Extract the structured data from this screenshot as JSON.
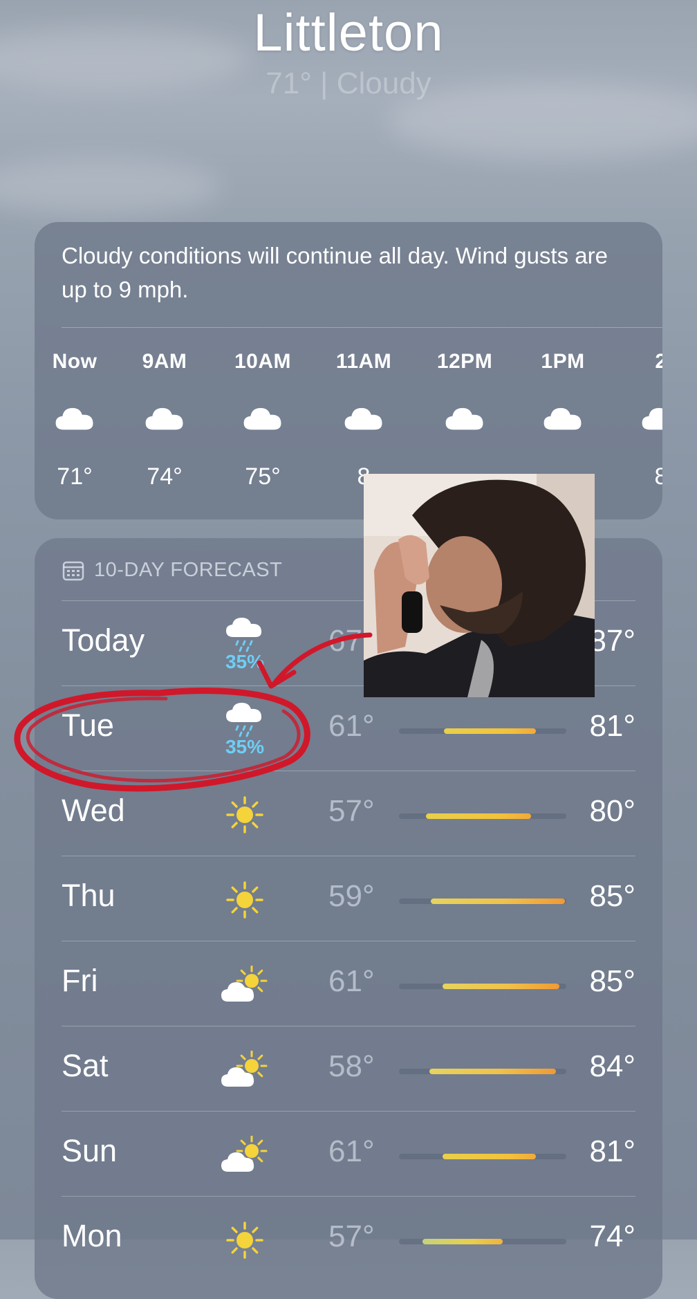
{
  "header": {
    "city": "Littleton",
    "subtitle": "71°  |  Cloudy"
  },
  "summary": {
    "text": "Cloudy conditions will continue all day. Wind gusts are up to 9 mph."
  },
  "hourly": [
    {
      "time": "Now",
      "icon": "cloud-icon",
      "temp": "71°"
    },
    {
      "time": "9AM",
      "icon": "cloud-icon",
      "temp": "74°"
    },
    {
      "time": "10AM",
      "icon": "cloud-icon",
      "temp": "75°"
    },
    {
      "time": "11AM",
      "icon": "cloud-icon",
      "temp": "8"
    },
    {
      "time": "12PM",
      "icon": "cloud-icon",
      "temp": ""
    },
    {
      "time": "1PM",
      "icon": "cloud-icon",
      "temp": ""
    },
    {
      "time": "2",
      "icon": "cloud-icon",
      "temp": "8"
    }
  ],
  "forecast": {
    "title": "10-DAY FORECAST",
    "icon": "calendar-icon",
    "days": [
      {
        "day": "Today",
        "icon": "cloud-rain-icon",
        "precip": "35%",
        "low": "67",
        "high": "87°",
        "range": [
          0.0,
          0.0
        ]
      },
      {
        "day": "Tue",
        "icon": "cloud-rain-icon",
        "precip": "35%",
        "low": "61°",
        "high": "81°",
        "range": [
          0.27,
          0.82
        ]
      },
      {
        "day": "Wed",
        "icon": "sun-icon",
        "precip": "",
        "low": "57°",
        "high": "80°",
        "range": [
          0.16,
          0.79
        ]
      },
      {
        "day": "Thu",
        "icon": "sun-icon",
        "precip": "",
        "low": "59°",
        "high": "85°",
        "range": [
          0.19,
          0.99
        ]
      },
      {
        "day": "Fri",
        "icon": "partly-sunny-icon",
        "precip": "",
        "low": "61°",
        "high": "85°",
        "range": [
          0.26,
          0.96
        ]
      },
      {
        "day": "Sat",
        "icon": "partly-sunny-icon",
        "precip": "",
        "low": "58°",
        "high": "84°",
        "range": [
          0.18,
          0.94
        ]
      },
      {
        "day": "Sun",
        "icon": "partly-sunny-icon",
        "precip": "",
        "low": "61°",
        "high": "81°",
        "range": [
          0.26,
          0.82
        ]
      },
      {
        "day": "Mon",
        "icon": "sun-icon",
        "precip": "",
        "low": "57°",
        "high": "74°",
        "range": [
          0.14,
          0.62
        ]
      }
    ]
  },
  "colors": {
    "rain": "#6fcdf5",
    "sun": "#f5d33a",
    "annotation": "#d0182a"
  }
}
